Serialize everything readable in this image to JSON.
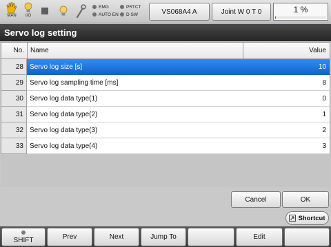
{
  "status_bar": {
    "man_label": "MAN",
    "io_label": "I/O",
    "lamps": {
      "emg": "EMG",
      "prtct": "PRTCT",
      "auto_en": "AUTO EN",
      "d_sw": "D SW"
    },
    "program_button": "VS068A4 A",
    "coord_button": "Joint  W 0 T 0",
    "speed_text": "1 %",
    "speed_fraction": 0.01,
    "icons": [
      "hand-icon",
      "lightbulb-icon",
      "stop-square-icon",
      "bulb-icon",
      "wrench-icon"
    ],
    "colors": {
      "hand_icon": "#f0b400",
      "lightbulb_icon": "#f2c94c"
    }
  },
  "window": {
    "title": "Servo log setting"
  },
  "table": {
    "headers": {
      "no": "No.",
      "name": "Name",
      "value": "Value"
    },
    "rows": [
      {
        "no": "28",
        "name": "Servo log size [s]",
        "value": "10",
        "selected": true
      },
      {
        "no": "29",
        "name": "Servo log sampling time [ms]",
        "value": "8",
        "selected": false
      },
      {
        "no": "30",
        "name": "Servo log data type(1)",
        "value": "0",
        "selected": false
      },
      {
        "no": "31",
        "name": "Servo log data type(2)",
        "value": "1",
        "selected": false
      },
      {
        "no": "32",
        "name": "Servo log data type(3)",
        "value": "2",
        "selected": false
      },
      {
        "no": "33",
        "name": "Servo log data type(4)",
        "value": "3",
        "selected": false
      }
    ],
    "selected_color": "#1f78e0"
  },
  "dialog": {
    "cancel_label": "Cancel",
    "ok_label": "OK"
  },
  "shortcut": {
    "label": "Shortcut"
  },
  "fkeys": {
    "f1": "SHIFT",
    "f2": "Prev",
    "f3": "Next",
    "f4": "Jump To",
    "f5": "",
    "f6": "Edit",
    "f7": ""
  }
}
